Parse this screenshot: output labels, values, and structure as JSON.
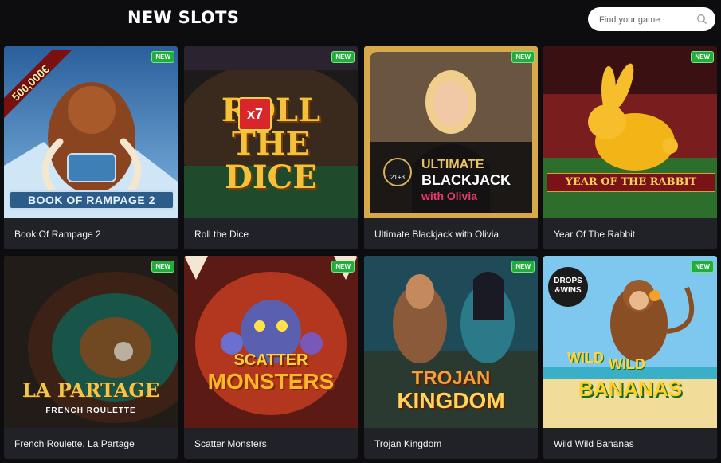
{
  "header": {
    "title": "NEW SLOTS",
    "search_placeholder": "Find your game"
  },
  "games": [
    {
      "name": "Book Of Rampage 2",
      "badge": "NEW",
      "art_text": "BOOK OF RAMPAGE 2",
      "ribbon": "500,000€"
    },
    {
      "name": "Roll the Dice",
      "badge": "NEW",
      "art_text": "ROLL THE DICE",
      "multiplier": "x7"
    },
    {
      "name": "Ultimate Blackjack with Olivia",
      "badge": "NEW",
      "art_line1": "ULTIMATE",
      "art_line2": "BLACKJACK",
      "art_line3": "with Olivia",
      "chip": "21+3"
    },
    {
      "name": "Year Of The Rabbit",
      "badge": "NEW",
      "art_text": "YEAR OF THE RABBIT"
    },
    {
      "name": "French Roulette. La Partage",
      "badge": "NEW",
      "art_line1": "LA PARTAGE",
      "art_line2": "FRENCH ROULETTE"
    },
    {
      "name": "Scatter Monsters",
      "badge": "NEW",
      "art_line1": "SCATTER",
      "art_line2": "MONSTERS"
    },
    {
      "name": "Trojan Kingdom",
      "badge": "NEW",
      "art_line1": "TROJAN",
      "art_line2": "KINGDOM"
    },
    {
      "name": "Wild Wild Bananas",
      "badge": "NEW",
      "art_line1": "WILD",
      "art_line2": "WILD",
      "art_line3": "BANANAS",
      "tag_line1": "DROPS",
      "tag_line2": "&WINS"
    }
  ],
  "colors": {
    "background": "#0d0d10",
    "card": "#202227",
    "badge": "#1fae3a"
  }
}
